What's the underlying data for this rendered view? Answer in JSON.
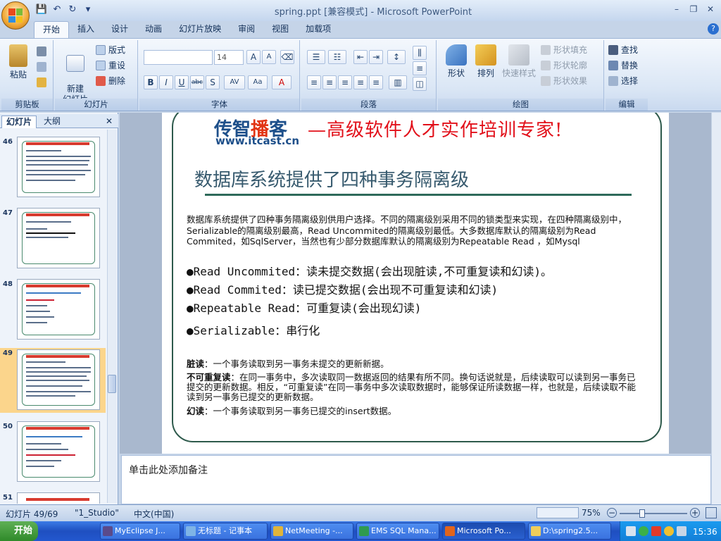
{
  "window": {
    "title": "spring.ppt [兼容模式] - Microsoft PowerPoint",
    "minimize": "–",
    "restore": "❐",
    "close": "✕"
  },
  "qat": {
    "save": "💾",
    "undo": "↶",
    "redo": "↻",
    "customize": "▾"
  },
  "tabs": [
    "开始",
    "插入",
    "设计",
    "动画",
    "幻灯片放映",
    "审阅",
    "视图",
    "加载项"
  ],
  "help": "?",
  "ribbon": {
    "clipboard": {
      "label": "剪贴板",
      "paste": "粘贴"
    },
    "slides": {
      "label": "幻灯片",
      "new_slide": "新建\n幻灯片",
      "layout": "版式",
      "reset": "重设",
      "delete": "删除"
    },
    "font": {
      "label": "字体",
      "font_name": "",
      "font_size": "14"
    },
    "paragraph": {
      "label": "段落"
    },
    "drawing": {
      "label": "绘图",
      "shapes": "形状",
      "arrange": "排列",
      "quick_styles": "快速样式",
      "fill": "形状填充",
      "outline": "形状轮廓",
      "effects": "形状效果"
    },
    "editing": {
      "label": "编辑",
      "find": "查找",
      "replace": "替换",
      "select": "选择"
    }
  },
  "left_pane": {
    "tab_slides": "幻灯片",
    "tab_outline": "大纲",
    "close": "✕",
    "thumbs": [
      {
        "num": "46"
      },
      {
        "num": "47"
      },
      {
        "num": "48"
      },
      {
        "num": "49"
      },
      {
        "num": "50"
      },
      {
        "num": "51"
      }
    ]
  },
  "slide": {
    "brand_left": "传智",
    "brand_mid": "播",
    "brand_right": "客",
    "slogan": "—高级软件人才实作培训专家!",
    "url": "www.itcast.cn",
    "heading": "数据库系统提供了四种事务隔离级",
    "paragraph": "数据库系统提供了四种事务隔离级别供用户选择。不同的隔离级别采用不同的锁类型来实现，在四种隔离级别中，Serializable的隔离级别最高，Read Uncommited的隔离级别最低。大多数据库默认的隔离级别为Read Commited，如SqlServer，当然也有少部分数据库默认的隔离级别为Repeatable Read ，如Mysql",
    "bullets": [
      "●Read Uncommited：读未提交数据(会出现脏读,不可重复读和幻读)。",
      "●Read Commited：读已提交数据(会出现不可重复读和幻读)",
      "●Repeatable Read：可重复读(会出现幻读)",
      "●Serializable：串行化"
    ],
    "dirty_term": "脏读",
    "dirty_def": "：一个事务读取到另一事务未提交的更新新据。",
    "nonrepeat_term": "不可重复读",
    "nonrepeat_def": "：在同一事务中，多次读取同一数据返回的结果有所不同。换句话说就是，后续读取可以读到另一事务已提交的更新数据。相反，“可重复读”在同一事务中多次读取数据时，能够保证所读数据一样，也就是，后续读取不能读到另一事务已提交的更新数据。",
    "phantom_term": "幻读",
    "phantom_def": "：一个事务读取到另一事务已提交的insert数据。"
  },
  "notes_placeholder": "单击此处添加备注",
  "status": {
    "slide_count": "幻灯片 49/69",
    "theme": "\"1_Studio\"",
    "language": "中文(中国)",
    "zoom": "75%"
  },
  "taskbar": {
    "start": "开始",
    "items": [
      "MyEclipse J...",
      "无标题 - 记事本",
      "NetMeeting -...",
      "EMS SQL Mana...",
      "Microsoft Po...",
      "D:\\spring2.5..."
    ],
    "clock": "15:36"
  },
  "colors": {
    "accent": "#1d4f8a",
    "brand_red": "#e2101a",
    "frame": "#2e5a4c"
  }
}
